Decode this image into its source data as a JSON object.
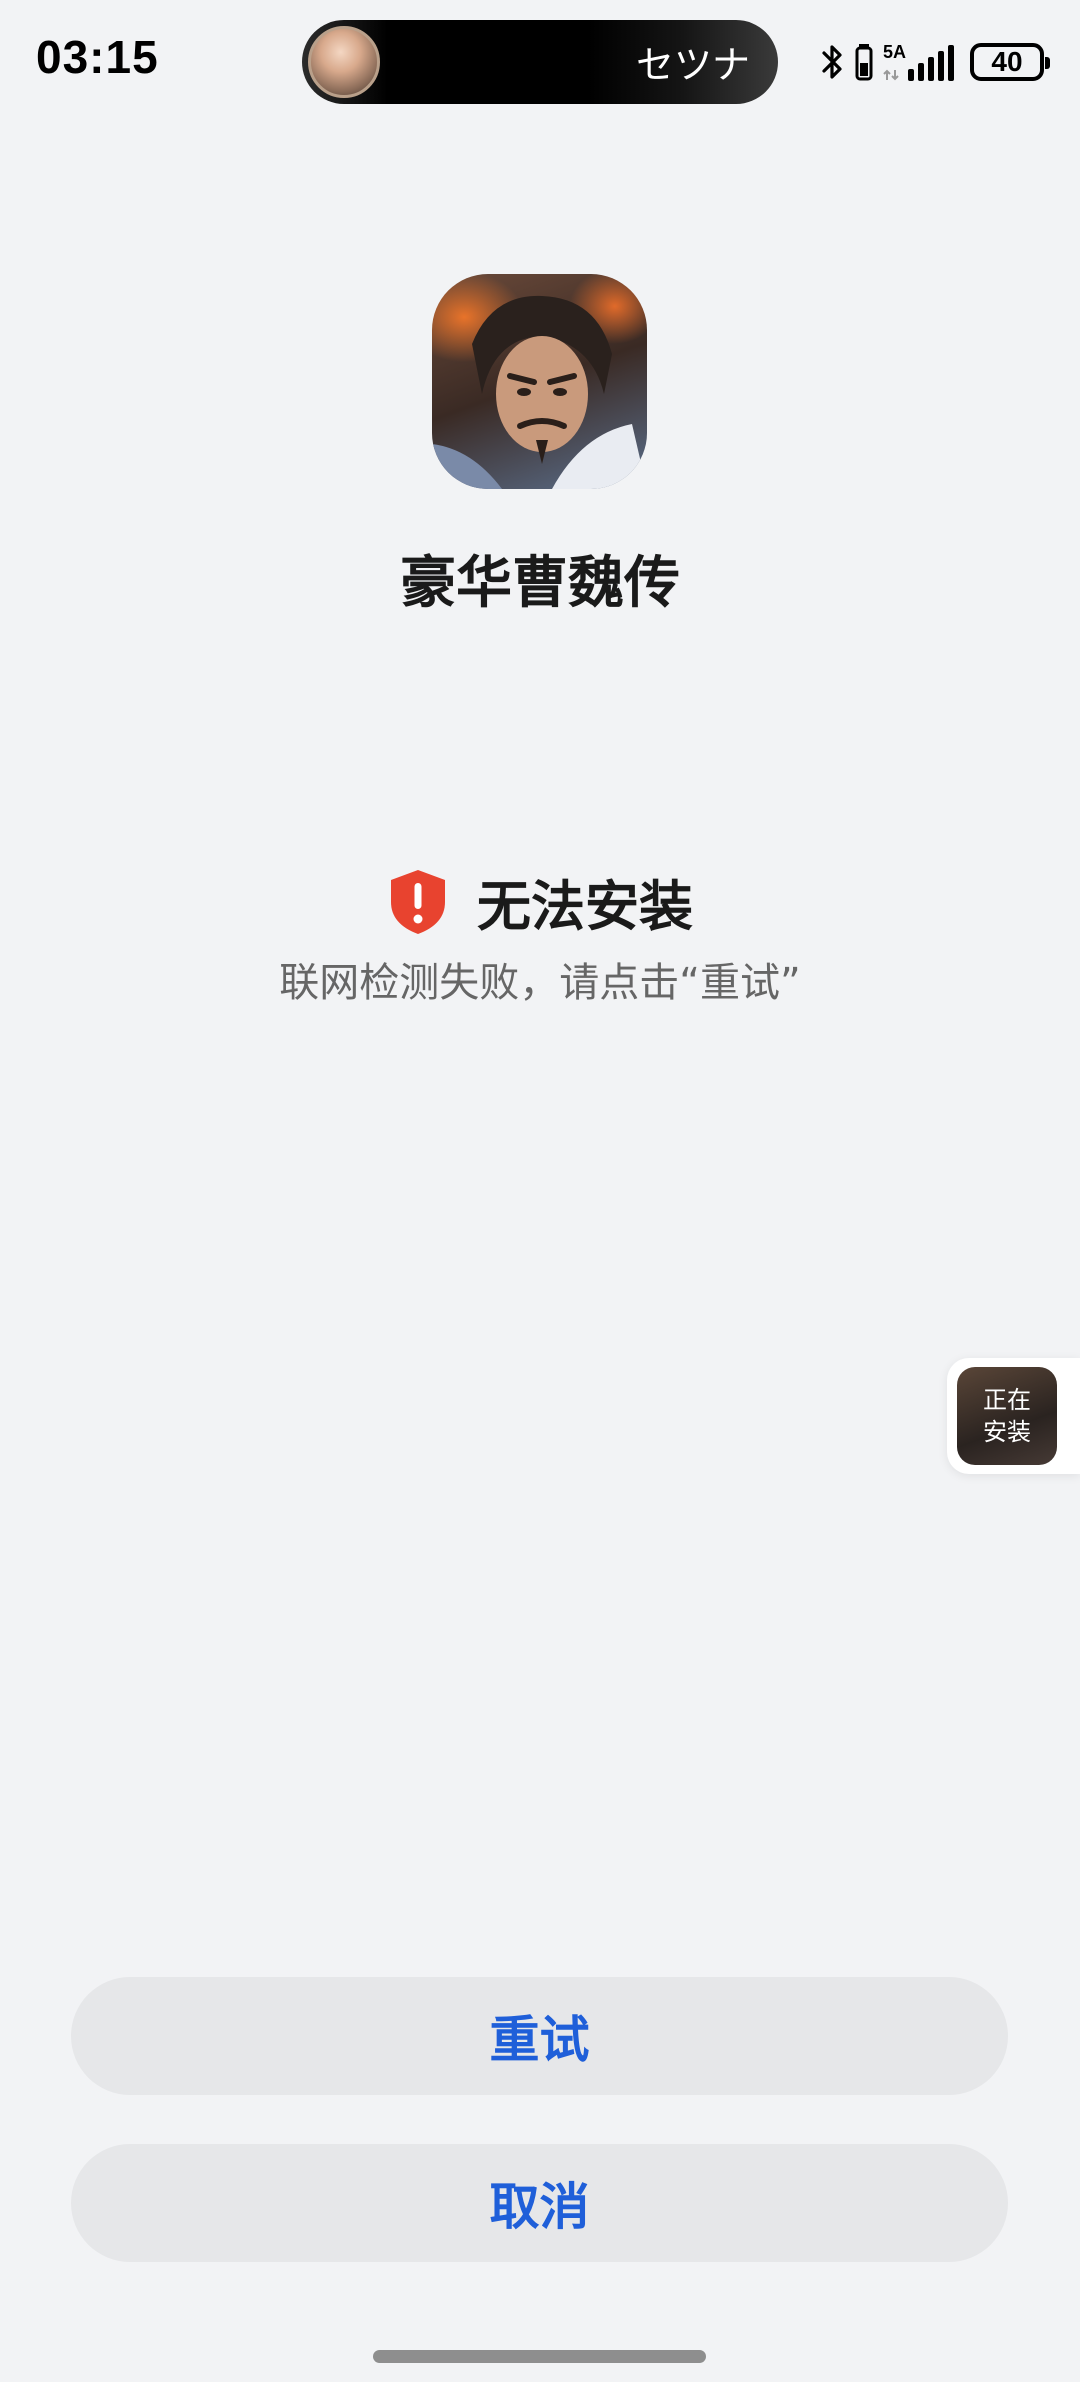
{
  "status_bar": {
    "time": "03:15",
    "live_activity_text": "セツナ",
    "network_label": "5A",
    "battery_level": "40",
    "icons": [
      "avatar-icon",
      "bluetooth-icon",
      "battery-saver-icon",
      "signal-icon"
    ]
  },
  "app": {
    "name": "豪华曹魏传",
    "icon": "app-icon"
  },
  "error": {
    "title": "无法安装",
    "description": "联网检测失败，请点击“重试”",
    "icon": "shield-alert-icon",
    "color": "#e8432f"
  },
  "floating_badge": {
    "line1": "正在",
    "line2": "安装"
  },
  "buttons": {
    "retry_label": "重试",
    "cancel_label": "取消",
    "text_color": "#1f5fd9",
    "background": "#e6e7e9"
  }
}
